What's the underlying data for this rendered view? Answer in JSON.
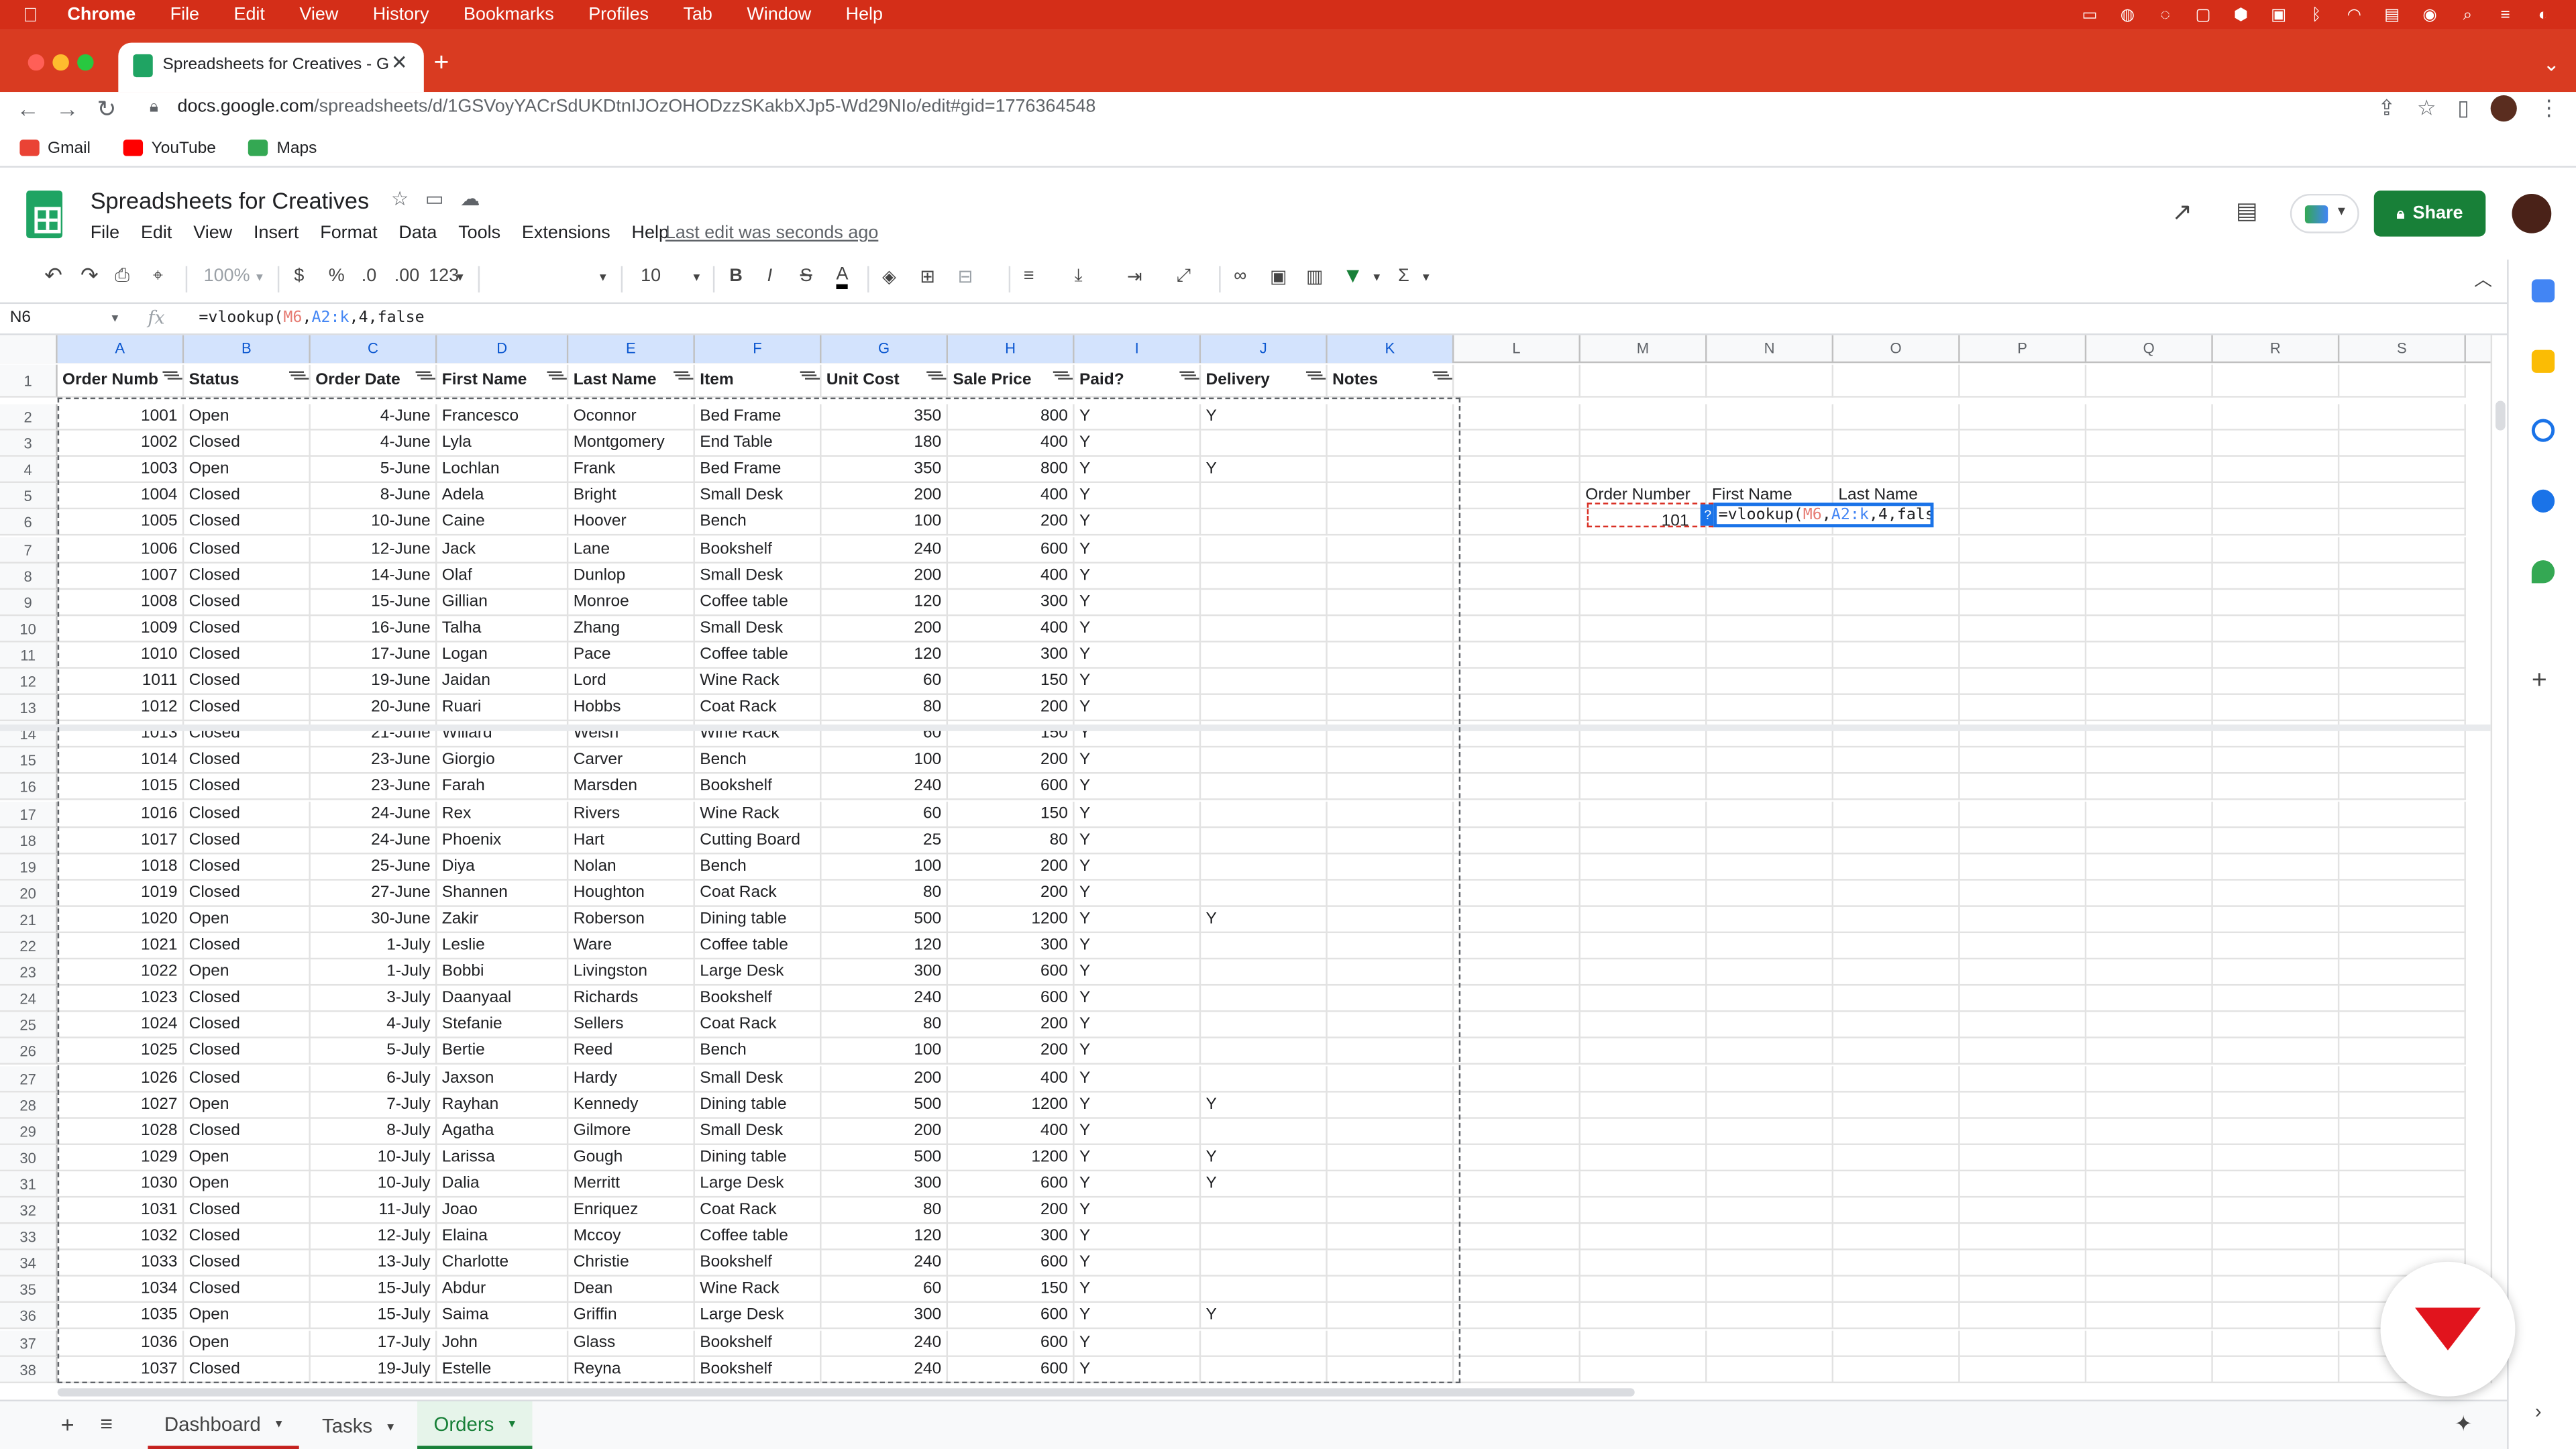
{
  "menubar": {
    "app": "Chrome",
    "items": [
      "File",
      "Edit",
      "View",
      "History",
      "Bookmarks",
      "Profiles",
      "Tab",
      "Window",
      "Help"
    ]
  },
  "browser": {
    "tab_title": "Spreadsheets for Creatives - G",
    "url_host": "docs.google.com",
    "url_path": "/spreadsheets/d/1GSVoyYACrSdUKDtnIJOzOHODzzSKakbXJp5-Wd29NIo/edit#gid=1776364548",
    "bookmarks": [
      "Gmail",
      "YouTube",
      "Maps"
    ]
  },
  "doc": {
    "title": "Spreadsheets for Creatives",
    "menus": [
      "File",
      "Edit",
      "View",
      "Insert",
      "Format",
      "Data",
      "Tools",
      "Extensions",
      "Help"
    ],
    "last_edit": "Last edit was seconds ago",
    "share_label": "Share"
  },
  "toolbar": {
    "zoom": "100%",
    "currency": "$",
    "percent": "%",
    "dec_less": ".0",
    "dec_more": ".00",
    "format": "123",
    "font_size": "10",
    "bold": "B",
    "italic": "I",
    "strike": "S",
    "text_color": "A"
  },
  "formula_bar": {
    "cell_ref": "N6",
    "fx": "fx",
    "prefix": "=vlookup(",
    "ref1": "M6",
    "mid": ",",
    "ref2": "A2:k",
    "suffix": ",4,false"
  },
  "grid": {
    "columns": [
      "A",
      "B",
      "C",
      "D",
      "E",
      "F",
      "G",
      "H",
      "I",
      "J",
      "K",
      "L",
      "M",
      "N",
      "O",
      "P",
      "Q",
      "R",
      "S"
    ],
    "headers": [
      "Order Numb",
      "Status",
      "Order Date",
      "First Name",
      "Last Name",
      "Item",
      "Unit Cost",
      "Sale Price",
      "Paid?",
      "Delivery",
      "Notes"
    ],
    "rows": [
      [
        "1001",
        "Open",
        "4-June",
        "Francesco",
        "Oconnor",
        "Bed Frame",
        "350",
        "800",
        "Y",
        "Y"
      ],
      [
        "1002",
        "Closed",
        "4-June",
        "Lyla",
        "Montgomery",
        "End Table",
        "180",
        "400",
        "Y",
        ""
      ],
      [
        "1003",
        "Open",
        "5-June",
        "Lochlan",
        "Frank",
        "Bed Frame",
        "350",
        "800",
        "Y",
        "Y"
      ],
      [
        "1004",
        "Closed",
        "8-June",
        "Adela",
        "Bright",
        "Small Desk",
        "200",
        "400",
        "Y",
        ""
      ],
      [
        "1005",
        "Closed",
        "10-June",
        "Caine",
        "Hoover",
        "Bench",
        "100",
        "200",
        "Y",
        ""
      ],
      [
        "1006",
        "Closed",
        "12-June",
        "Jack",
        "Lane",
        "Bookshelf",
        "240",
        "600",
        "Y",
        ""
      ],
      [
        "1007",
        "Closed",
        "14-June",
        "Olaf",
        "Dunlop",
        "Small Desk",
        "200",
        "400",
        "Y",
        ""
      ],
      [
        "1008",
        "Closed",
        "15-June",
        "Gillian",
        "Monroe",
        "Coffee table",
        "120",
        "300",
        "Y",
        ""
      ],
      [
        "1009",
        "Closed",
        "16-June",
        "Talha",
        "Zhang",
        "Small Desk",
        "200",
        "400",
        "Y",
        ""
      ],
      [
        "1010",
        "Closed",
        "17-June",
        "Logan",
        "Pace",
        "Coffee table",
        "120",
        "300",
        "Y",
        ""
      ],
      [
        "1011",
        "Closed",
        "19-June",
        "Jaidan",
        "Lord",
        "Wine Rack",
        "60",
        "150",
        "Y",
        ""
      ],
      [
        "1012",
        "Closed",
        "20-June",
        "Ruari",
        "Hobbs",
        "Coat Rack",
        "80",
        "200",
        "Y",
        ""
      ],
      [
        "1013",
        "Closed",
        "21-June",
        "Willard",
        "Welsh",
        "Wine Rack",
        "60",
        "150",
        "Y",
        ""
      ],
      [
        "1014",
        "Closed",
        "23-June",
        "Giorgio",
        "Carver",
        "Bench",
        "100",
        "200",
        "Y",
        ""
      ],
      [
        "1015",
        "Closed",
        "23-June",
        "Farah",
        "Marsden",
        "Bookshelf",
        "240",
        "600",
        "Y",
        ""
      ],
      [
        "1016",
        "Closed",
        "24-June",
        "Rex",
        "Rivers",
        "Wine Rack",
        "60",
        "150",
        "Y",
        ""
      ],
      [
        "1017",
        "Closed",
        "24-June",
        "Phoenix",
        "Hart",
        "Cutting Board",
        "25",
        "80",
        "Y",
        ""
      ],
      [
        "1018",
        "Closed",
        "25-June",
        "Diya",
        "Nolan",
        "Bench",
        "100",
        "200",
        "Y",
        ""
      ],
      [
        "1019",
        "Closed",
        "27-June",
        "Shannen",
        "Houghton",
        "Coat Rack",
        "80",
        "200",
        "Y",
        ""
      ],
      [
        "1020",
        "Open",
        "30-June",
        "Zakir",
        "Roberson",
        "Dining table",
        "500",
        "1200",
        "Y",
        "Y"
      ],
      [
        "1021",
        "Closed",
        "1-July",
        "Leslie",
        "Ware",
        "Coffee table",
        "120",
        "300",
        "Y",
        ""
      ],
      [
        "1022",
        "Open",
        "1-July",
        "Bobbi",
        "Livingston",
        "Large Desk",
        "300",
        "600",
        "Y",
        ""
      ],
      [
        "1023",
        "Closed",
        "3-July",
        "Daanyaal",
        "Richards",
        "Bookshelf",
        "240",
        "600",
        "Y",
        ""
      ],
      [
        "1024",
        "Closed",
        "4-July",
        "Stefanie",
        "Sellers",
        "Coat Rack",
        "80",
        "200",
        "Y",
        ""
      ],
      [
        "1025",
        "Closed",
        "5-July",
        "Bertie",
        "Reed",
        "Bench",
        "100",
        "200",
        "Y",
        ""
      ],
      [
        "1026",
        "Closed",
        "6-July",
        "Jaxson",
        "Hardy",
        "Small Desk",
        "200",
        "400",
        "Y",
        ""
      ],
      [
        "1027",
        "Open",
        "7-July",
        "Rayhan",
        "Kennedy",
        "Dining table",
        "500",
        "1200",
        "Y",
        "Y"
      ],
      [
        "1028",
        "Closed",
        "8-July",
        "Agatha",
        "Gilmore",
        "Small Desk",
        "200",
        "400",
        "Y",
        ""
      ],
      [
        "1029",
        "Open",
        "10-July",
        "Larissa",
        "Gough",
        "Dining table",
        "500",
        "1200",
        "Y",
        "Y"
      ],
      [
        "1030",
        "Open",
        "10-July",
        "Dalia",
        "Merritt",
        "Large Desk",
        "300",
        "600",
        "Y",
        "Y"
      ],
      [
        "1031",
        "Closed",
        "11-July",
        "Joao",
        "Enriquez",
        "Coat Rack",
        "80",
        "200",
        "Y",
        ""
      ],
      [
        "1032",
        "Closed",
        "12-July",
        "Elaina",
        "Mccoy",
        "Coffee table",
        "120",
        "300",
        "Y",
        ""
      ],
      [
        "1033",
        "Closed",
        "13-July",
        "Charlotte",
        "Christie",
        "Bookshelf",
        "240",
        "600",
        "Y",
        ""
      ],
      [
        "1034",
        "Closed",
        "15-July",
        "Abdur",
        "Dean",
        "Wine Rack",
        "60",
        "150",
        "Y",
        ""
      ],
      [
        "1035",
        "Open",
        "15-July",
        "Saima",
        "Griffin",
        "Large Desk",
        "300",
        "600",
        "Y",
        "Y"
      ],
      [
        "1036",
        "Open",
        "17-July",
        "John",
        "Glass",
        "Bookshelf",
        "240",
        "600",
        "Y",
        ""
      ],
      [
        "1037",
        "Closed",
        "19-July",
        "Estelle",
        "Reyna",
        "Bookshelf",
        "240",
        "600",
        "Y",
        ""
      ]
    ],
    "lookup": {
      "m5": "Order Number",
      "n5": "First Name",
      "o5": "Last Name",
      "m6": "101",
      "n6_prefix": "=vlookup(",
      "n6_ref1": "M6",
      "n6_mid": ",",
      "n6_ref2": "A2:k",
      "n6_suffix": ",4,false",
      "hint": "?"
    }
  },
  "sheets": [
    {
      "name": "Dashboard"
    },
    {
      "name": "Tasks"
    },
    {
      "name": "Orders"
    }
  ],
  "colors": {
    "menubar": "#d42e18",
    "accent": "#188038",
    "selection": "#1a73e8"
  }
}
